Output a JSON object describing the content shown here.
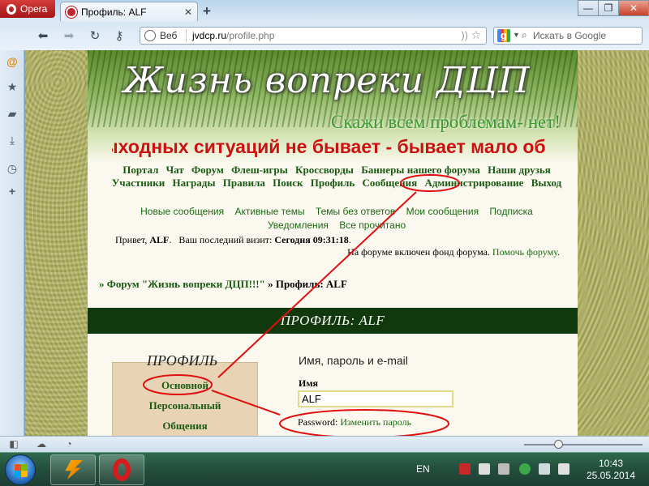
{
  "browser": {
    "menu_label": "Opera",
    "tab_title": "Профиль: ALF",
    "address": {
      "prefix": "Веб",
      "host": "jvdcp.ru",
      "path": "/profile.php"
    },
    "search_placeholder": "Искать в Google"
  },
  "site": {
    "title": "Жизнь вопреки ДЦП",
    "slogan": "Скажи всем проблемам- нет!",
    "marquee": "ыходных ситуаций не бывает - бывает мало об"
  },
  "main_menu": [
    "Портал",
    "Чат",
    "Форум",
    "Флеш-игры",
    "Кроссворды",
    "Баннеры нашего форума",
    "Наши друзья",
    "Участники",
    "Награды",
    "Правила",
    "Поиск",
    "Профиль",
    "Сообщения",
    "Администрирование",
    "Выход"
  ],
  "sub_menu": [
    "Новые сообщения",
    "Активные темы",
    "Темы без ответов",
    "Мои сообщения",
    "Подписка",
    "Уведомления",
    "Все прочитано"
  ],
  "welcome": {
    "greeting": "Привет,",
    "user": "ALF",
    "visit_label": "Ваш последний визит:",
    "visit_time": "Сегодня 09:31:18",
    "fund_text": "На форуме включен фонд форума.",
    "fund_link": "Помочь форуму"
  },
  "breadcrumb": {
    "forum_link": "» Форум \"Жизнь вопреки ДЦП!!!\"",
    "current": "» Профиль: ALF"
  },
  "profile": {
    "header": "ПРОФИЛЬ: ALF",
    "menu_title": "ПРОФИЛЬ",
    "menu_items": [
      "Основной",
      "Персональный",
      "Общения"
    ],
    "form_title": "Имя, пароль и e-mail",
    "name_label": "Имя",
    "name_value": "ALF",
    "password_label": "Password:",
    "password_link": "Изменить пароль"
  },
  "taskbar": {
    "lang": "EN",
    "time": "10:43",
    "date": "25.05.2014"
  },
  "colors": {
    "link_green": "#1b5a14",
    "header_bar": "#12380d",
    "marquee_red": "#cc1111",
    "annotation_red": "#e01010"
  }
}
